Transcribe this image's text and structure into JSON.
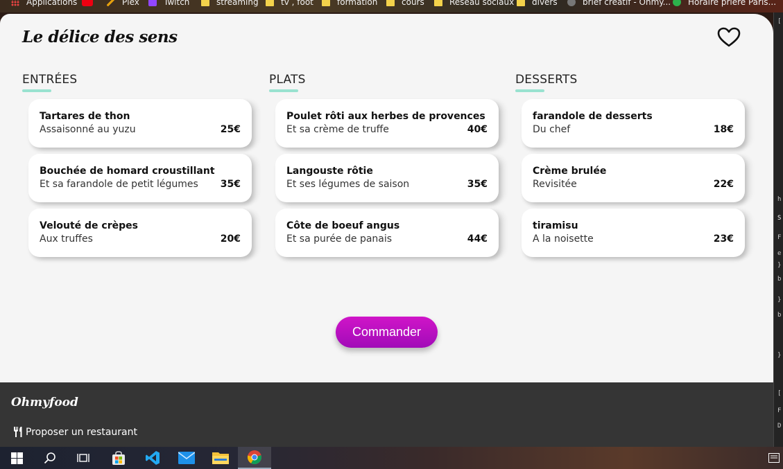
{
  "browser": {
    "bookmarks": [
      {
        "label": "Applications",
        "icon": "apps-grid-icon"
      },
      {
        "label": "",
        "icon": "youtube-icon"
      },
      {
        "label": "Plex",
        "icon": "plex-icon"
      },
      {
        "label": "Twitch",
        "icon": "twitch-icon"
      },
      {
        "label": "streaming",
        "icon": "folder-icon"
      },
      {
        "label": "tv , foot",
        "icon": "folder-icon"
      },
      {
        "label": "formation",
        "icon": "folder-icon"
      },
      {
        "label": "cours",
        "icon": "folder-icon"
      },
      {
        "label": "Réseau sociaux",
        "icon": "folder-icon"
      },
      {
        "label": "divers",
        "icon": "folder-icon"
      },
      {
        "label": "brief creatif - Ohmy...",
        "icon": "globe-icon"
      },
      {
        "label": "Horaire prière Paris...",
        "icon": "leaf-icon"
      }
    ]
  },
  "header": {
    "brand": "Le délice des sens",
    "favorite_icon": "heart-icon"
  },
  "menu": [
    {
      "title": "ENTRÉES",
      "items": [
        {
          "name": "Tartares de thon",
          "description": "Assaisonné au yuzu",
          "price": "25€"
        },
        {
          "name": "Bouchée de homard croustillant",
          "description": "Et sa farandole de petit légumes",
          "price": "35€"
        },
        {
          "name": "Velouté de crèpes",
          "description": "Aux truffes",
          "price": "20€"
        }
      ]
    },
    {
      "title": "PLATS",
      "items": [
        {
          "name": "Poulet rôti aux herbes de provences",
          "description": "Et sa crème de truffe",
          "price": "40€"
        },
        {
          "name": "Langouste rôtie",
          "description": "Et ses légumes de saison",
          "price": "35€"
        },
        {
          "name": "Côte de boeuf angus",
          "description": "Et sa purée de panais",
          "price": "44€"
        }
      ]
    },
    {
      "title": "DESSERTS",
      "items": [
        {
          "name": "farandole de desserts",
          "description": "Du chef",
          "price": "18€"
        },
        {
          "name": "Crème brulée",
          "description": "Revisitée",
          "price": "22€"
        },
        {
          "name": "tiramisu",
          "description": "A la noisette",
          "price": "23€"
        }
      ]
    }
  ],
  "order_button": "Commander",
  "footer": {
    "logo": "Ohmyfood",
    "link": "Proposer un restaurant",
    "link_icon": "utensils-icon"
  },
  "devtools": {
    "glyphs": [
      "[",
      "h",
      "S",
      "F",
      "e",
      "}",
      "b",
      "}",
      "b",
      "}",
      "[",
      "F",
      "D"
    ]
  },
  "taskbar": {
    "items": [
      "windows-start-icon",
      "search-icon",
      "task-view-icon",
      "store-icon",
      "vscode-icon",
      "mail-icon",
      "file-explorer-icon",
      "chrome-icon"
    ]
  },
  "colors": {
    "accent_underline": "#99e2d0",
    "button_gradient_top": "#d015c8",
    "button_gradient_bottom": "#a10bb8",
    "footer_bg": "#353535",
    "page_bg": "#f5f5f5"
  }
}
